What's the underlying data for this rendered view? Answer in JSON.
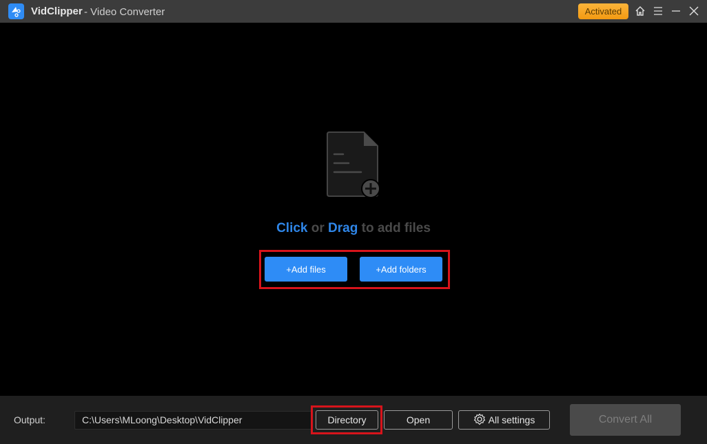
{
  "titlebar": {
    "app_name": "VidClipper",
    "app_subtitle": "- Video Converter",
    "activated_badge": "Activated"
  },
  "main": {
    "hint_click": "Click",
    "hint_or": " or ",
    "hint_drag": "Drag",
    "hint_rest": " to add files",
    "add_files_label": "+Add files",
    "add_folders_label": "+Add folders"
  },
  "footer": {
    "output_label": "Output:",
    "output_path": "C:\\Users\\MLoong\\Desktop\\VidClipper",
    "directory_label": "Directory",
    "open_label": "Open",
    "all_settings_label": "All settings",
    "convert_all_label": "Convert All"
  },
  "colors": {
    "accent": "#2e8cf6",
    "badge": "#f7a823",
    "highlight_frame": "#d7141b"
  }
}
